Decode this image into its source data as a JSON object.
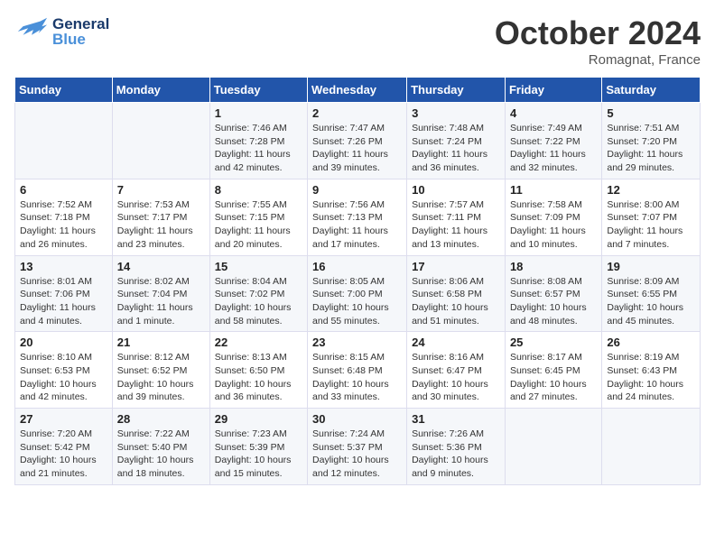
{
  "header": {
    "logo_general": "General",
    "logo_blue": "Blue",
    "month_title": "October 2024",
    "location": "Romagnat, France"
  },
  "days_of_week": [
    "Sunday",
    "Monday",
    "Tuesday",
    "Wednesday",
    "Thursday",
    "Friday",
    "Saturday"
  ],
  "weeks": [
    [
      {
        "day": "",
        "info": ""
      },
      {
        "day": "",
        "info": ""
      },
      {
        "day": "1",
        "sunrise": "Sunrise: 7:46 AM",
        "sunset": "Sunset: 7:28 PM",
        "daylight": "Daylight: 11 hours and 42 minutes."
      },
      {
        "day": "2",
        "sunrise": "Sunrise: 7:47 AM",
        "sunset": "Sunset: 7:26 PM",
        "daylight": "Daylight: 11 hours and 39 minutes."
      },
      {
        "day": "3",
        "sunrise": "Sunrise: 7:48 AM",
        "sunset": "Sunset: 7:24 PM",
        "daylight": "Daylight: 11 hours and 36 minutes."
      },
      {
        "day": "4",
        "sunrise": "Sunrise: 7:49 AM",
        "sunset": "Sunset: 7:22 PM",
        "daylight": "Daylight: 11 hours and 32 minutes."
      },
      {
        "day": "5",
        "sunrise": "Sunrise: 7:51 AM",
        "sunset": "Sunset: 7:20 PM",
        "daylight": "Daylight: 11 hours and 29 minutes."
      }
    ],
    [
      {
        "day": "6",
        "sunrise": "Sunrise: 7:52 AM",
        "sunset": "Sunset: 7:18 PM",
        "daylight": "Daylight: 11 hours and 26 minutes."
      },
      {
        "day": "7",
        "sunrise": "Sunrise: 7:53 AM",
        "sunset": "Sunset: 7:17 PM",
        "daylight": "Daylight: 11 hours and 23 minutes."
      },
      {
        "day": "8",
        "sunrise": "Sunrise: 7:55 AM",
        "sunset": "Sunset: 7:15 PM",
        "daylight": "Daylight: 11 hours and 20 minutes."
      },
      {
        "day": "9",
        "sunrise": "Sunrise: 7:56 AM",
        "sunset": "Sunset: 7:13 PM",
        "daylight": "Daylight: 11 hours and 17 minutes."
      },
      {
        "day": "10",
        "sunrise": "Sunrise: 7:57 AM",
        "sunset": "Sunset: 7:11 PM",
        "daylight": "Daylight: 11 hours and 13 minutes."
      },
      {
        "day": "11",
        "sunrise": "Sunrise: 7:58 AM",
        "sunset": "Sunset: 7:09 PM",
        "daylight": "Daylight: 11 hours and 10 minutes."
      },
      {
        "day": "12",
        "sunrise": "Sunrise: 8:00 AM",
        "sunset": "Sunset: 7:07 PM",
        "daylight": "Daylight: 11 hours and 7 minutes."
      }
    ],
    [
      {
        "day": "13",
        "sunrise": "Sunrise: 8:01 AM",
        "sunset": "Sunset: 7:06 PM",
        "daylight": "Daylight: 11 hours and 4 minutes."
      },
      {
        "day": "14",
        "sunrise": "Sunrise: 8:02 AM",
        "sunset": "Sunset: 7:04 PM",
        "daylight": "Daylight: 11 hours and 1 minute."
      },
      {
        "day": "15",
        "sunrise": "Sunrise: 8:04 AM",
        "sunset": "Sunset: 7:02 PM",
        "daylight": "Daylight: 10 hours and 58 minutes."
      },
      {
        "day": "16",
        "sunrise": "Sunrise: 8:05 AM",
        "sunset": "Sunset: 7:00 PM",
        "daylight": "Daylight: 10 hours and 55 minutes."
      },
      {
        "day": "17",
        "sunrise": "Sunrise: 8:06 AM",
        "sunset": "Sunset: 6:58 PM",
        "daylight": "Daylight: 10 hours and 51 minutes."
      },
      {
        "day": "18",
        "sunrise": "Sunrise: 8:08 AM",
        "sunset": "Sunset: 6:57 PM",
        "daylight": "Daylight: 10 hours and 48 minutes."
      },
      {
        "day": "19",
        "sunrise": "Sunrise: 8:09 AM",
        "sunset": "Sunset: 6:55 PM",
        "daylight": "Daylight: 10 hours and 45 minutes."
      }
    ],
    [
      {
        "day": "20",
        "sunrise": "Sunrise: 8:10 AM",
        "sunset": "Sunset: 6:53 PM",
        "daylight": "Daylight: 10 hours and 42 minutes."
      },
      {
        "day": "21",
        "sunrise": "Sunrise: 8:12 AM",
        "sunset": "Sunset: 6:52 PM",
        "daylight": "Daylight: 10 hours and 39 minutes."
      },
      {
        "day": "22",
        "sunrise": "Sunrise: 8:13 AM",
        "sunset": "Sunset: 6:50 PM",
        "daylight": "Daylight: 10 hours and 36 minutes."
      },
      {
        "day": "23",
        "sunrise": "Sunrise: 8:15 AM",
        "sunset": "Sunset: 6:48 PM",
        "daylight": "Daylight: 10 hours and 33 minutes."
      },
      {
        "day": "24",
        "sunrise": "Sunrise: 8:16 AM",
        "sunset": "Sunset: 6:47 PM",
        "daylight": "Daylight: 10 hours and 30 minutes."
      },
      {
        "day": "25",
        "sunrise": "Sunrise: 8:17 AM",
        "sunset": "Sunset: 6:45 PM",
        "daylight": "Daylight: 10 hours and 27 minutes."
      },
      {
        "day": "26",
        "sunrise": "Sunrise: 8:19 AM",
        "sunset": "Sunset: 6:43 PM",
        "daylight": "Daylight: 10 hours and 24 minutes."
      }
    ],
    [
      {
        "day": "27",
        "sunrise": "Sunrise: 7:20 AM",
        "sunset": "Sunset: 5:42 PM",
        "daylight": "Daylight: 10 hours and 21 minutes."
      },
      {
        "day": "28",
        "sunrise": "Sunrise: 7:22 AM",
        "sunset": "Sunset: 5:40 PM",
        "daylight": "Daylight: 10 hours and 18 minutes."
      },
      {
        "day": "29",
        "sunrise": "Sunrise: 7:23 AM",
        "sunset": "Sunset: 5:39 PM",
        "daylight": "Daylight: 10 hours and 15 minutes."
      },
      {
        "day": "30",
        "sunrise": "Sunrise: 7:24 AM",
        "sunset": "Sunset: 5:37 PM",
        "daylight": "Daylight: 10 hours and 12 minutes."
      },
      {
        "day": "31",
        "sunrise": "Sunrise: 7:26 AM",
        "sunset": "Sunset: 5:36 PM",
        "daylight": "Daylight: 10 hours and 9 minutes."
      },
      {
        "day": "",
        "info": ""
      },
      {
        "day": "",
        "info": ""
      }
    ]
  ]
}
